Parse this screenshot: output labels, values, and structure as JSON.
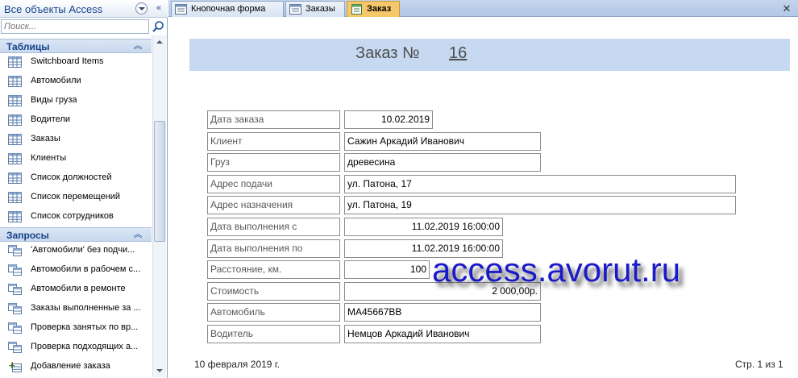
{
  "nav": {
    "title": "Все объекты Access",
    "search_placeholder": "Поиск...",
    "groups": {
      "tables": {
        "label": "Таблицы",
        "items": [
          "Switchboard Items",
          "Автомобили",
          "Виды груза",
          "Водители",
          "Заказы",
          "Клиенты",
          "Список должностей",
          "Список перемещений",
          "Список сотрудников"
        ]
      },
      "queries": {
        "label": "Запросы",
        "items": [
          "'Автомобили' без подчи...",
          "Автомобили в рабочем с...",
          "Автомобили в ремонте",
          "Заказы выполненные за ...",
          "Проверка занятых по вр...",
          "Проверка подходящих а...",
          "Добавление заказа"
        ]
      }
    }
  },
  "tabs": [
    {
      "label": "Кнопочная форма",
      "icon": "form-icon"
    },
    {
      "label": "Заказы",
      "icon": "form-icon"
    },
    {
      "label": "Заказ",
      "icon": "report-icon",
      "active": true
    }
  ],
  "report": {
    "title_label": "Заказ №",
    "title_number": "16",
    "fields": [
      {
        "label": "Дата заказа",
        "value": "10.02.2019"
      },
      {
        "label": "Клиент",
        "value": "Сажин Аркадий Иванович"
      },
      {
        "label": "Груз",
        "value": "древесина"
      },
      {
        "label": "Адрес подачи",
        "value": "ул. Патона, 17"
      },
      {
        "label": "Адрес назначения",
        "value": "ул. Патона, 19"
      },
      {
        "label": "Дата выполнения с",
        "value": "11.02.2019 16:00:00"
      },
      {
        "label": "Дата выполнения по",
        "value": "11.02.2019 16:00:00"
      },
      {
        "label": "Расстояние, км.",
        "value": "100"
      },
      {
        "label": "Стоимость",
        "value": "2 000,00р."
      },
      {
        "label": "Автомобиль",
        "value": "MA45667BB"
      },
      {
        "label": "Водитель",
        "value": "Немцов Аркадий Иванович"
      }
    ],
    "footer_date": "10 февраля 2019 г.",
    "footer_page": "Стр. 1 из 1"
  },
  "watermark": "access.avorut.ru",
  "colors": {
    "accent": "#15428b",
    "title_band": "#c6d9f1",
    "active_tab": "#f6c86a",
    "watermark": "#1a1ac8"
  }
}
